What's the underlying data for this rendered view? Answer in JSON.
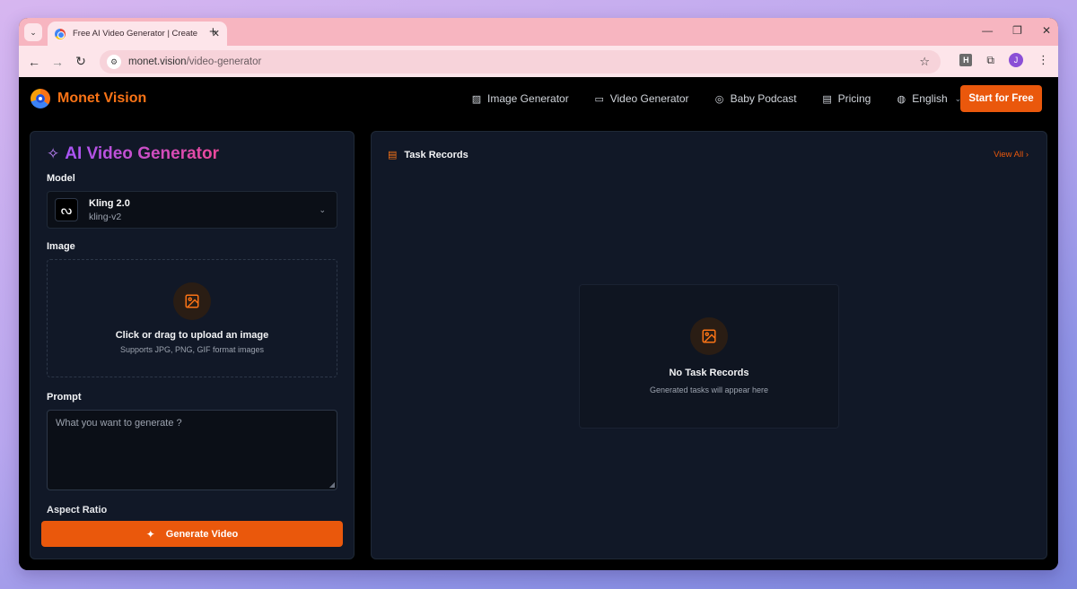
{
  "browser": {
    "tab_title": "Free AI Video Generator | Create",
    "url_domain": "monet.vision",
    "url_path": "/video-generator",
    "profile_initial": "J",
    "extension_label": "H"
  },
  "nav": {
    "brand": "Monet Vision",
    "items": [
      {
        "label": "Image Generator",
        "icon": "image-icon"
      },
      {
        "label": "Video Generator",
        "icon": "video-icon"
      },
      {
        "label": "Baby Podcast",
        "icon": "podcast-icon"
      },
      {
        "label": "Pricing",
        "icon": "credit-card-icon"
      },
      {
        "label": "English",
        "icon": "globe-icon"
      }
    ],
    "cta": "Start for Free"
  },
  "generator": {
    "title": "AI Video Generator",
    "model_label": "Model",
    "model_name": "Kling 2.0",
    "model_id": "kling-v2",
    "image_label": "Image",
    "upload_main": "Click or drag to upload an image",
    "upload_sub": "Supports JPG, PNG, GIF format images",
    "prompt_label": "Prompt",
    "prompt_placeholder": "What you want to generate ?",
    "aspect_label": "Aspect Ratio",
    "generate_button": "Generate Video"
  },
  "tasks": {
    "title": "Task Records",
    "view_all": "View All",
    "empty_title": "No Task Records",
    "empty_sub": "Generated tasks will appear here"
  },
  "colors": {
    "accent": "#ea580c",
    "title_gradient_start": "#a855f7",
    "title_gradient_end": "#ec4899",
    "panel_bg": "#111827",
    "tabstrip_bg": "#f7b5c0"
  }
}
